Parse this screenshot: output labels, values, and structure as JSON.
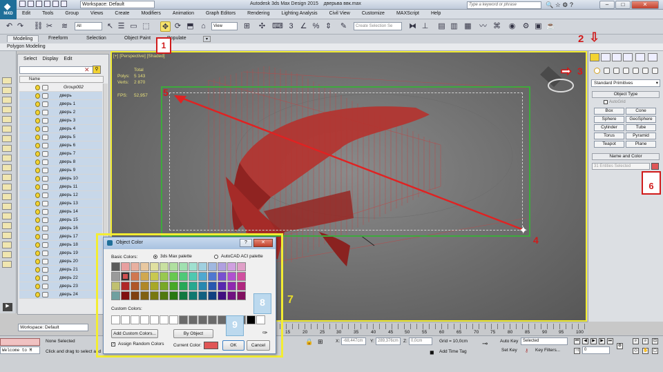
{
  "app": {
    "logo_label": "MXD",
    "window_title": "Autodesk 3ds Max Design 2015",
    "file_name": "дверьва ввк.max",
    "search_placeholder": "Type a keyword or phrase",
    "workspace_label": "Workspace: Default"
  },
  "menu": [
    "Edit",
    "Tools",
    "Group",
    "Views",
    "Create",
    "Modifiers",
    "Animation",
    "Graph Editors",
    "Rendering",
    "Lighting Analysis",
    "Civil View",
    "Customize",
    "MAXScript",
    "Help"
  ],
  "toolbar": {
    "selection_filter": "All",
    "reference_coord": "View",
    "named_selection_placeholder": "Create Selection Se"
  },
  "ribbon": {
    "tabs": [
      "Modeling",
      "Freeform",
      "Selection",
      "Object Paint",
      "Populate"
    ],
    "active_tab": "Modeling",
    "subpanel": "Polygon Modeling"
  },
  "scene_explorer": {
    "menu": [
      "Select",
      "Display",
      "Edit"
    ],
    "column_name": "Name",
    "group_name": "Group002",
    "items": [
      "дверь",
      "дверь 1",
      "дверь 2",
      "дверь 3",
      "дверь 4",
      "дверь 5",
      "дверь 6",
      "дверь 7",
      "дверь 8",
      "дверь 9",
      "дверь 10",
      "дверь 11",
      "дверь 12",
      "дверь 13",
      "дверь 14",
      "дверь 15",
      "дверь 16",
      "дверь 17",
      "дверь 18",
      "дверь 19",
      "дверь 20",
      "дверь 21",
      "дверь 22",
      "дверь 23",
      "дверь 24"
    ]
  },
  "viewport": {
    "label": "[+] [Perspective] [Shaded]",
    "stats_header": "Total",
    "polys_label": "Polys:",
    "polys_value": "5 143",
    "verts_label": "Verts:",
    "verts_value": "2 870",
    "fps_label": "FPS:",
    "fps_value": "52,957"
  },
  "command_panel": {
    "category": "Standard Primitives",
    "object_type_title": "Object Type",
    "autogrid": "AutoGrid",
    "primitives": [
      "Box",
      "Cone",
      "Sphere",
      "GeoSphere",
      "Cylinder",
      "Tube",
      "Torus",
      "Pyramid",
      "Teapot",
      "Plane"
    ],
    "name_color_title": "Name and Color",
    "name_value": "31 Entities Selected",
    "object_color": "#e05656"
  },
  "timeline": {
    "ticks": [
      "15",
      "20",
      "25",
      "30",
      "35",
      "40",
      "45",
      "50",
      "55",
      "60",
      "65",
      "70",
      "75",
      "80",
      "85",
      "90",
      "95",
      "100"
    ]
  },
  "status": {
    "welcome": "Welcome to M",
    "none_selected": "None Selected",
    "prompt": "Click and drag to select and",
    "x_label": "X:",
    "x_value": "-68,447cm",
    "y_label": "Y:",
    "y_value": "289,376cm",
    "z_label": "Z:",
    "z_value": "0,0cm",
    "grid": "Grid = 10,0cm",
    "add_time_tag": "Add Time Tag",
    "auto_key": "Auto Key",
    "set_key": "Set Key",
    "selected_combo": "Selected",
    "key_filters": "Key Filters...",
    "frame": "0"
  },
  "dialog": {
    "title": "Object Color",
    "help": "?",
    "basic_colors_label": "Basic Colors:",
    "option_max": "3ds Max palette",
    "option_aci": "AutoCAD ACI palette",
    "custom_colors_label": "Custom Colors:",
    "add_custom": "Add Custom Colors...",
    "by_object": "By Object",
    "assign_random": "Assign Random Colors",
    "current_color_label": "Current Color:",
    "current_color": "#e05656",
    "ok": "OK",
    "cancel": "Cancel",
    "palette": [
      "#5a5a5a",
      "#e8a0a0",
      "#e8b0a0",
      "#e8c8a0",
      "#e0e0a0",
      "#c8e0a0",
      "#b0e0a0",
      "#a0e0b0",
      "#a0e0d0",
      "#a0d0e0",
      "#a0b8e0",
      "#b0a0e0",
      "#d0a0e0",
      "#e0a0c8",
      "#9a9a9a",
      "#d05050",
      "#d07850",
      "#d0a850",
      "#c8c850",
      "#98c850",
      "#68c850",
      "#50c878",
      "#50c8b0",
      "#50a8d0",
      "#5078d0",
      "#7850d0",
      "#b050d0",
      "#d050a0",
      "#c0c070",
      "#b02828",
      "#b05828",
      "#b08828",
      "#a8a828",
      "#78a828",
      "#48a828",
      "#28a858",
      "#28a890",
      "#2888b0",
      "#2858b0",
      "#5828b0",
      "#9028b0",
      "#b02880",
      "#70a0a0",
      "#801010",
      "#804010",
      "#806010",
      "#787810",
      "#507810",
      "#287810",
      "#107840",
      "#107870",
      "#106080",
      "#104080",
      "#401080",
      "#701080",
      "#801060"
    ],
    "selected_swatch": 15,
    "custom_colors": [
      "#ffffff",
      "#ffffff",
      "#ffffff",
      "#ffffff",
      "#ffffff",
      "#ffffff",
      "#ffffff",
      "#6a6a6a",
      "#6a6a6a",
      "#6a6a6a",
      "#6a6a6a",
      "#6a6a6a",
      "#6a6a6a",
      "#6a6a6a",
      "#000000",
      "#ffffff"
    ]
  },
  "annotations": [
    "1",
    "2",
    "3",
    "4",
    "5",
    "6",
    "7",
    "8",
    "9"
  ]
}
